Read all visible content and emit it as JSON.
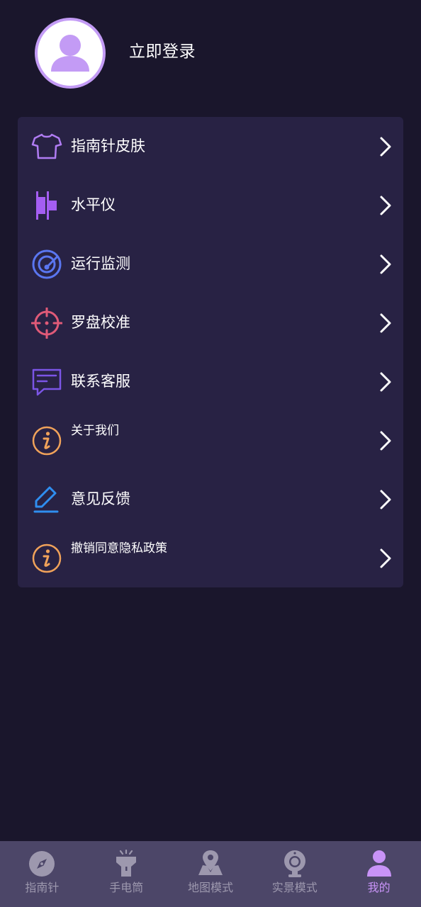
{
  "header": {
    "login_text": "立即登录",
    "avatar_icon": "user-avatar-icon"
  },
  "menu": {
    "items": [
      {
        "label": "指南针皮肤",
        "icon": "tshirt-icon",
        "color": "#b07cf3"
      },
      {
        "label": "水平仪",
        "icon": "level-icon",
        "color": "#a45ef2"
      },
      {
        "label": "运行监测",
        "icon": "radar-icon",
        "color": "#5a76f0"
      },
      {
        "label": "罗盘校准",
        "icon": "crosshair-icon",
        "color": "#e05a78"
      },
      {
        "label": "联系客服",
        "icon": "chat-icon",
        "color": "#7b55e6"
      },
      {
        "label": "关于我们",
        "icon": "info-icon",
        "color": "#f0a25a"
      },
      {
        "label": "意见反馈",
        "icon": "edit-icon",
        "color": "#2f8ef0"
      },
      {
        "label": "撤销同意隐私政策",
        "icon": "info-icon",
        "color": "#f0a25a"
      }
    ],
    "chevron_icon": "chevron-right-icon"
  },
  "tabbar": {
    "tabs": [
      {
        "label": "指南针",
        "icon": "compass-icon",
        "active": false
      },
      {
        "label": "手电筒",
        "icon": "flashlight-icon",
        "active": false
      },
      {
        "label": "地图模式",
        "icon": "map-pin-icon",
        "active": false
      },
      {
        "label": "实景模式",
        "icon": "camera-icon",
        "active": false
      },
      {
        "label": "我的",
        "icon": "user-icon",
        "active": true
      }
    ]
  },
  "colors": {
    "background": "#1a162c",
    "card": "#282244",
    "tabbar": "#4c4668",
    "accent": "#c893f7",
    "tab_inactive": "#9d98ae"
  }
}
